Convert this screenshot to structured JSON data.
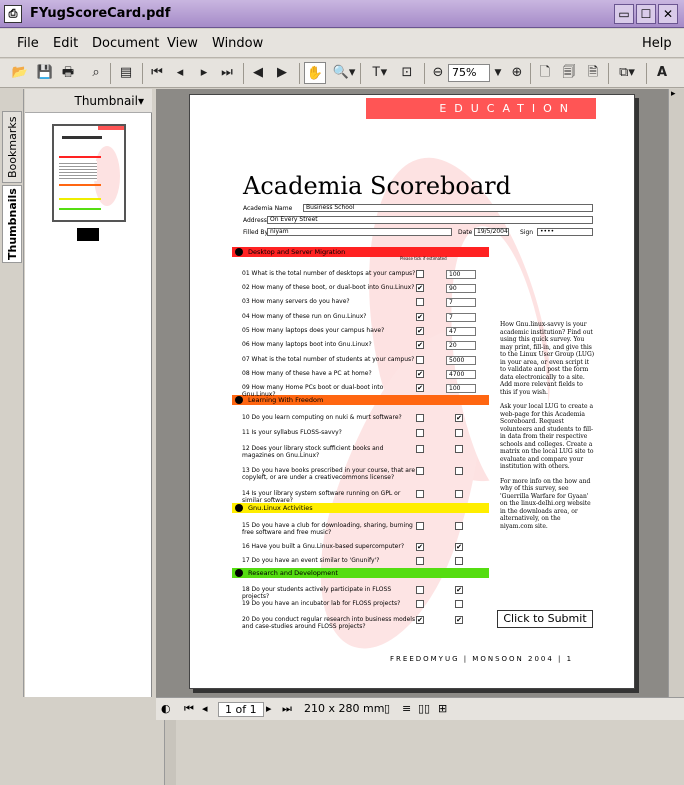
{
  "window": {
    "title": "FYugScoreCard.pdf",
    "min": "▭",
    "max": "☐",
    "close": "✕"
  },
  "menu": {
    "file": "File",
    "edit": "Edit",
    "document": "Document",
    "view": "View",
    "window": "Window",
    "help": "Help"
  },
  "toolbar": {
    "zoom": "75%"
  },
  "sidebar": {
    "bookmarks_tab": "Bookmarks",
    "thumbnails_tab": "Thumbnails",
    "header": "Thumbnail▾"
  },
  "status": {
    "page": "1 of 1",
    "size": "210 x 280 mm"
  },
  "doc": {
    "band": "EDUCATION",
    "title": "Academia Scoreboard",
    "name_label": "Academia Name",
    "name_value": "Business School",
    "address_label": "Address",
    "address_value": "On Every Street",
    "filled_label": "Filled By",
    "filled_value": "niyam",
    "date_label": "Date",
    "date_value": "19/5/2004",
    "sign_label": "Sign",
    "sign_value": "••••",
    "please_tick": "Please tick if estimated",
    "sections": [
      {
        "label": "Desktop and Server Migration",
        "color": "#ff2222"
      },
      {
        "label": "Learning With Freedom",
        "color": "#ff6611"
      },
      {
        "label": "Gnu.Linux Activities",
        "color": "#ffee00"
      },
      {
        "label": "Research and Development",
        "color": "#55dd11"
      }
    ],
    "questions": [
      {
        "text": "01 What is the total number of desktops at your campus?",
        "tick": "",
        "val": "100"
      },
      {
        "text": "02 How many of these boot, or dual-boot into Gnu.Linux?",
        "tick": "✔",
        "val": "90"
      },
      {
        "text": "03 How many servers do you have?",
        "tick": "",
        "val": "7"
      },
      {
        "text": "04 How many of these run on Gnu.Linux?",
        "tick": "✔",
        "val": "7"
      },
      {
        "text": "05 How many laptops does your campus have?",
        "tick": "✔",
        "val": "47"
      },
      {
        "text": "06 How many laptops boot into Gnu.Linux?",
        "tick": "✔",
        "val": "20"
      },
      {
        "text": "07 What is the total number of students at your campus?",
        "tick": "",
        "val": "5000"
      },
      {
        "text": "08 How many of these have a PC at home?",
        "tick": "✔",
        "val": "4700"
      },
      {
        "text": "09 How many Home PCs boot or dual-boot into Gnu.Linux?",
        "tick": "✔",
        "val": "100"
      },
      {
        "text": "10 Do you learn computing on nuki & murt software?",
        "a": "",
        "b": "✔"
      },
      {
        "text": "11 Is your syllabus FLOSS-savvy?",
        "a": "",
        "b": ""
      },
      {
        "text": "12 Does your library stock sufficient books and magazines on Gnu.Linux?",
        "a": "",
        "b": ""
      },
      {
        "text": "13 Do you have books prescribed in your course, that are copyleft, or are under a creativecommons license?",
        "a": "",
        "b": ""
      },
      {
        "text": "14 Is your library system software running on GPL or similar software?",
        "a": "",
        "b": ""
      },
      {
        "text": "15 Do you have a club for downloading, sharing, burning free software and free music?",
        "a": "",
        "b": ""
      },
      {
        "text": "16 Have you built a Gnu.Linux-based supercomputer?",
        "a": "✔",
        "b": "✔"
      },
      {
        "text": "17 Do you have an event similar to 'Gnunify'?",
        "a": "",
        "b": ""
      },
      {
        "text": "18 Do your students actively participate in FLOSS projects?",
        "a": "",
        "b": "✔"
      },
      {
        "text": "19 Do you have an incubator lab for FLOSS projects?",
        "a": "",
        "b": ""
      },
      {
        "text": "20 Do you conduct regular research into business models and case-studies around FLOSS projects?",
        "a": "✔",
        "b": "✔"
      }
    ],
    "side1": "How Gnu.linux-savvy is your academic institution? Find out using this quick survey. You may print, fill-in, and give this to the Linux User Group (LUG) in your area, or even script it to validate and post the form data electronically to a site. Add more relevant fields to this if you wish.",
    "side2": "Ask your local LUG to create a web-page for this Academia Scoreboard. Request volunteers and students to fill-in data from their respective schools and colleges. Create a matrix on the local LUG site to evaluate and compare your institution with others.",
    "side3": "For more info on the how and why of this survey, see 'Guerrilla Warfare for Gyaan' on the linux-delhi.org website in the downloads area, or alternatively, on the niyam.com site.",
    "submit": "Click to Submit",
    "footer": "FREEDOMYUG | MONSOON 2004 | 1"
  }
}
